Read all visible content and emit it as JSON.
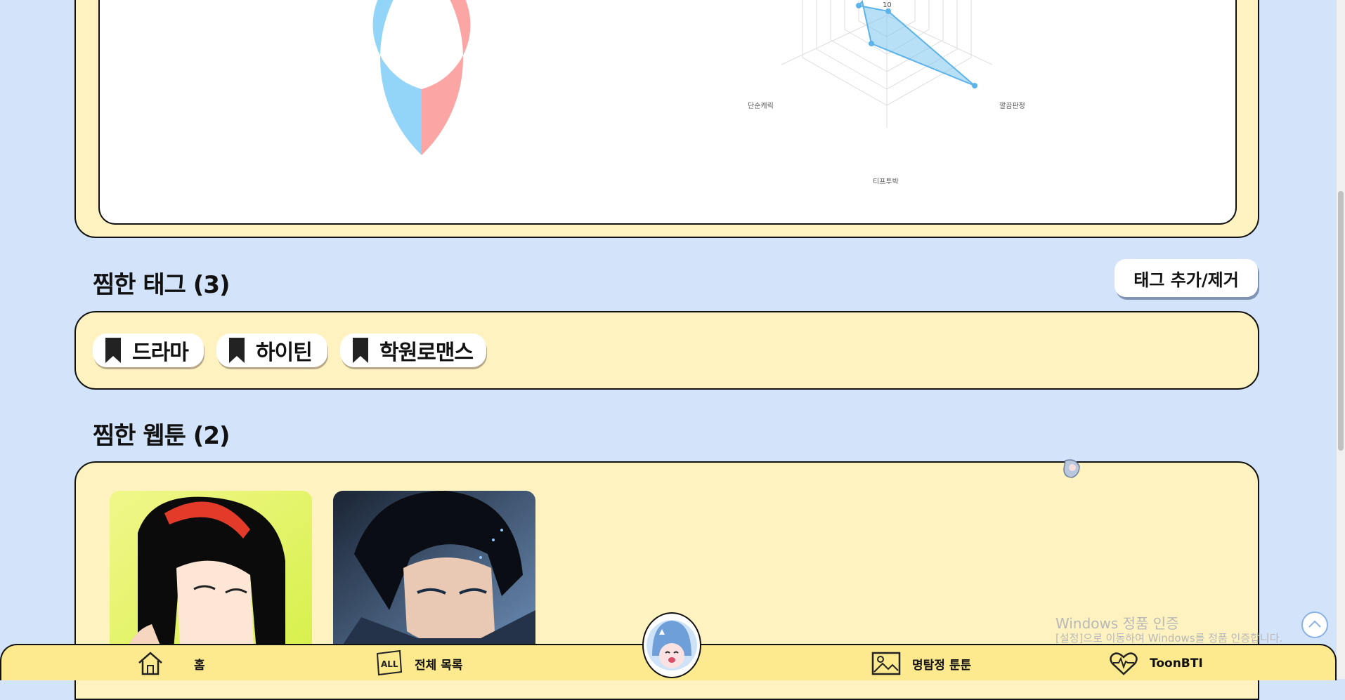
{
  "stats": {
    "donut": {
      "segments": [
        {
          "value": 50,
          "color": "#fca5a5"
        },
        {
          "value": 50,
          "color": "#93d5f8"
        }
      ]
    },
    "radar": {
      "tick_label": "10",
      "labels": [
        "단순캐릭",
        "깔끔판정",
        "티프투박"
      ],
      "color": "#7cc4ef"
    }
  },
  "tags_section": {
    "title": "찜한 태그 (3)",
    "button_label": "태그 추가/제거"
  },
  "tags": [
    {
      "label": "드라마"
    },
    {
      "label": "하이틴"
    },
    {
      "label": "학원로맨스"
    }
  ],
  "webtoons_section": {
    "title": "찜한 웹툰 (2)"
  },
  "nav": {
    "home": "홈",
    "all_list": "전체 목록",
    "detective": "명탐정 툰툰",
    "toonbti": "ToonBTI",
    "all_badge": "ALL"
  },
  "watermark": {
    "line1": "Windows 정품 인증",
    "line2": "[설정]으로 이동하여 Windows를 정품 인증합니다."
  }
}
